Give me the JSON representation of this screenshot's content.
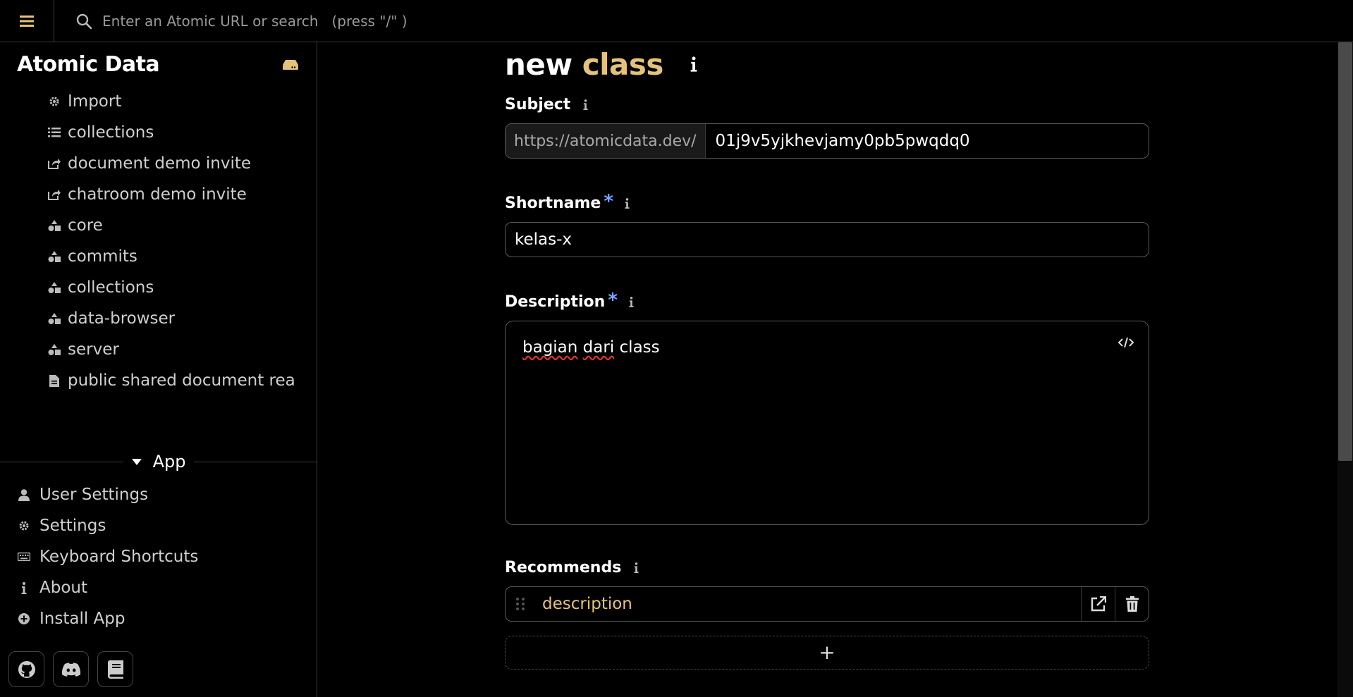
{
  "topbar": {
    "search_placeholder": "Enter an Atomic URL or search   (press \"/\" )"
  },
  "sidebar": {
    "brand": "Atomic Data",
    "items": [
      {
        "label": "Import",
        "icon": "gear-icon"
      },
      {
        "label": "collections",
        "icon": "list-icon"
      },
      {
        "label": "document demo invite",
        "icon": "share-icon"
      },
      {
        "label": "chatroom demo invite",
        "icon": "share-icon"
      },
      {
        "label": "core",
        "icon": "shapes-icon"
      },
      {
        "label": "commits",
        "icon": "shapes-icon"
      },
      {
        "label": "collections",
        "icon": "shapes-icon"
      },
      {
        "label": "data-browser",
        "icon": "shapes-icon"
      },
      {
        "label": "server",
        "icon": "shapes-icon"
      },
      {
        "label": "public shared document rea",
        "icon": "document-icon"
      }
    ],
    "app_section": {
      "label": "App",
      "items": [
        {
          "label": "User Settings",
          "icon": "user-icon"
        },
        {
          "label": "Settings",
          "icon": "gear-icon"
        },
        {
          "label": "Keyboard Shortcuts",
          "icon": "keyboard-icon"
        },
        {
          "label": "About",
          "icon": "info-icon"
        },
        {
          "label": "Install App",
          "icon": "plus-circle-icon"
        }
      ]
    },
    "social": [
      "github-icon",
      "discord-icon",
      "book-icon"
    ]
  },
  "main": {
    "title_prefix": "new",
    "title_class": "class",
    "subject": {
      "label": "Subject",
      "prefix": "https://atomicdata.dev/",
      "value": "01j9v5yjkhevjamy0pb5pwqdq0"
    },
    "shortname": {
      "label": "Shortname",
      "required": "*",
      "value": "kelas-x"
    },
    "description": {
      "label": "Description",
      "required": "*",
      "value_word": "bagian",
      "value_word2": "dari",
      "value_rest": "class"
    },
    "recommends": {
      "label": "Recommends",
      "items": [
        "description"
      ],
      "add_label": "+"
    }
  },
  "colors": {
    "accent": "#e5c27a",
    "required": "#7aa6ff",
    "border": "#5a5a5a"
  }
}
